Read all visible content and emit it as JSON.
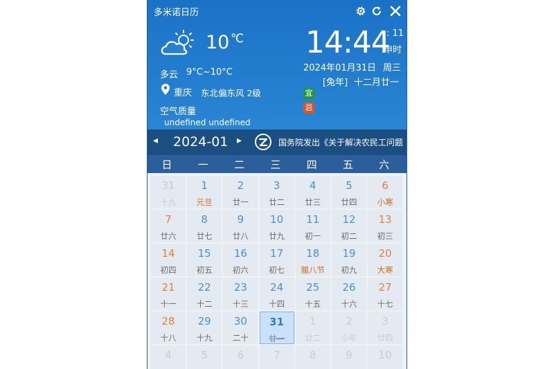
{
  "app": {
    "title": "多米诺日历"
  },
  "controls": {
    "settings_icon": "gear-icon",
    "refresh_icon": "refresh-icon",
    "close_icon": "close-icon"
  },
  "weather": {
    "icon": "cloudy-sun-icon",
    "temperature": "10",
    "unit": "℃",
    "condition": "多云",
    "range": "9°C~10°C",
    "city": "重庆",
    "wind": "东北偏东风 2级",
    "air_quality_label": "空气质量",
    "air_quality_value": "undefined undefined"
  },
  "clock": {
    "time": "14:44",
    "seconds": ": 11",
    "shichen": "申时"
  },
  "date": {
    "gregorian": "2024年01月31日",
    "weekday": "周三",
    "lunar_year": "[兔年]",
    "lunar_date": "十二月廿一",
    "yi": "宜",
    "ji": "忌"
  },
  "nav": {
    "prev": "◂",
    "month": "2024-01",
    "next": "▸",
    "news": "国务院发出《关于解决农民工问题"
  },
  "weekdays": [
    "日",
    "一",
    "二",
    "三",
    "四",
    "五",
    "六"
  ],
  "calendar": [
    [
      {
        "d": "31",
        "l": "十九",
        "type": "other"
      },
      {
        "d": "1",
        "l": "元旦",
        "type": "fest"
      },
      {
        "d": "2",
        "l": "廿一"
      },
      {
        "d": "3",
        "l": "廿二"
      },
      {
        "d": "4",
        "l": "廿三"
      },
      {
        "d": "5",
        "l": "廿四"
      },
      {
        "d": "6",
        "l": "小寒",
        "type": "wkfest"
      }
    ],
    [
      {
        "d": "7",
        "l": "廿六",
        "type": "wk"
      },
      {
        "d": "8",
        "l": "廿七"
      },
      {
        "d": "9",
        "l": "廿八"
      },
      {
        "d": "10",
        "l": "廿九"
      },
      {
        "d": "11",
        "l": "初一"
      },
      {
        "d": "12",
        "l": "初二"
      },
      {
        "d": "13",
        "l": "初三",
        "type": "wk"
      }
    ],
    [
      {
        "d": "14",
        "l": "初四",
        "type": "wk"
      },
      {
        "d": "15",
        "l": "初五"
      },
      {
        "d": "16",
        "l": "初六"
      },
      {
        "d": "17",
        "l": "初七"
      },
      {
        "d": "18",
        "l": "腊八节",
        "type": "fest"
      },
      {
        "d": "19",
        "l": "初九"
      },
      {
        "d": "20",
        "l": "大寒",
        "type": "wkfest"
      }
    ],
    [
      {
        "d": "21",
        "l": "十一",
        "type": "wk"
      },
      {
        "d": "22",
        "l": "十二"
      },
      {
        "d": "23",
        "l": "十三"
      },
      {
        "d": "24",
        "l": "十四"
      },
      {
        "d": "25",
        "l": "十五"
      },
      {
        "d": "26",
        "l": "十六"
      },
      {
        "d": "27",
        "l": "十七",
        "type": "wk"
      }
    ],
    [
      {
        "d": "28",
        "l": "十八",
        "type": "wk"
      },
      {
        "d": "29",
        "l": "十九"
      },
      {
        "d": "30",
        "l": "二十"
      },
      {
        "d": "31",
        "l": "廿一",
        "type": "today"
      },
      {
        "d": "1",
        "l": "廿二",
        "type": "other"
      },
      {
        "d": "2",
        "l": "小年",
        "type": "other"
      },
      {
        "d": "3",
        "l": "廿四",
        "type": "other"
      }
    ],
    [
      {
        "d": "4",
        "l": "",
        "type": "other"
      },
      {
        "d": "5",
        "l": "",
        "type": "other"
      },
      {
        "d": "6",
        "l": "",
        "type": "other"
      },
      {
        "d": "7",
        "l": "",
        "type": "other"
      },
      {
        "d": "8",
        "l": "",
        "type": "other"
      },
      {
        "d": "9",
        "l": "",
        "type": "other"
      },
      {
        "d": "10",
        "l": "",
        "type": "other"
      }
    ]
  ]
}
